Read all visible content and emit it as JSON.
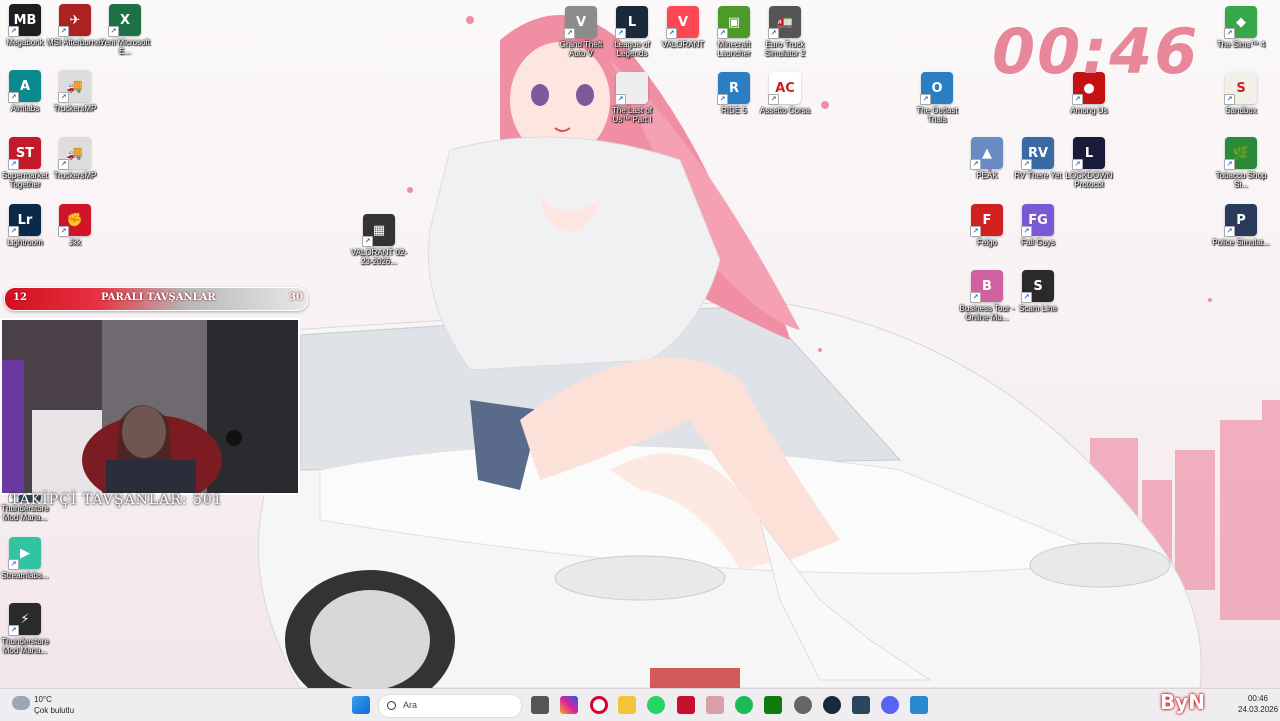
{
  "clock": {
    "time": "00:46"
  },
  "desktop_icons": [
    {
      "id": "megabonk",
      "label": "Megabonk",
      "color": "#1e1e1e",
      "glyph": "MB"
    },
    {
      "id": "msi-afterburner",
      "label": "MSI Afterburner",
      "color": "#a22",
      "glyph": "✈"
    },
    {
      "id": "excel",
      "label": "Yeni Microsoft E...",
      "color": "#1e7145",
      "glyph": "X"
    },
    {
      "id": "aimlab",
      "label": "Aimlabs",
      "color": "#0a8a8f",
      "glyph": "A"
    },
    {
      "id": "trucker-mp-1",
      "label": "TruckersMP",
      "color": "#ddd",
      "glyph": "🚚"
    },
    {
      "id": "supermarket",
      "label": "Supermarket Together",
      "color": "#c21a2a",
      "glyph": "ST"
    },
    {
      "id": "trucker-mp-2",
      "label": "TruckersMP",
      "color": "#ddd",
      "glyph": "🚚"
    },
    {
      "id": "lightroom",
      "label": "Lightroom",
      "color": "#0a2a4a",
      "glyph": "Lr"
    },
    {
      "id": "jkk",
      "label": "Jkk",
      "color": "#d01528",
      "glyph": "✊"
    },
    {
      "id": "valorant-video",
      "label": "VALORANT 02-23-2026...",
      "color": "#333",
      "glyph": "▦"
    },
    {
      "id": "gta5",
      "label": "Grand Theft Auto V",
      "color": "#8c8c8c",
      "glyph": "V"
    },
    {
      "id": "lol",
      "label": "League of Legends",
      "color": "#1b2a3a",
      "glyph": "L"
    },
    {
      "id": "valorant",
      "label": "VALORANT",
      "color": "#ff4655",
      "glyph": "V"
    },
    {
      "id": "minecraft",
      "label": "Minecraft Launcher",
      "color": "#4c9a2a",
      "glyph": "▣"
    },
    {
      "id": "ets2",
      "label": "Euro Truck Simulator 2",
      "color": "#555",
      "glyph": "🚛"
    },
    {
      "id": "last-of-us",
      "label": "The Last of Us™ Part I",
      "color": "#eee",
      "glyph": ""
    },
    {
      "id": "ride5",
      "label": "RIDE 5",
      "color": "#2a7fc4",
      "glyph": "R"
    },
    {
      "id": "assetto",
      "label": "Assetto Corsa",
      "color": "#fff",
      "glyph": "AC"
    },
    {
      "id": "outlast",
      "label": "The Outlast Trials",
      "color": "#2a7fc4",
      "glyph": "O"
    },
    {
      "id": "among-us",
      "label": "Among Us",
      "color": "#c51111",
      "glyph": "●"
    },
    {
      "id": "sims4",
      "label": "The Sims™ 4",
      "color": "#3aa64a",
      "glyph": "◆"
    },
    {
      "id": "sandbox",
      "label": "Sandbox",
      "color": "#f0f0e8",
      "glyph": "S"
    },
    {
      "id": "peak",
      "label": "PEAK",
      "color": "#6a8ac4",
      "glyph": "▲"
    },
    {
      "id": "rv-there",
      "label": "RV There Yet",
      "color": "#3a6aa4",
      "glyph": "RV"
    },
    {
      "id": "lockdown",
      "label": "LOCKDOWN Protocol",
      "color": "#1a1a3a",
      "glyph": "L"
    },
    {
      "id": "tobacco",
      "label": "Tobacco Shop Si...",
      "color": "#2a8a3a",
      "glyph": "🌿"
    },
    {
      "id": "felgo",
      "label": "Felgo",
      "color": "#d02020",
      "glyph": "F"
    },
    {
      "id": "fall-guys",
      "label": "Fall Guys",
      "color": "#7a5ad4",
      "glyph": "FG"
    },
    {
      "id": "police-sim",
      "label": "Police Simulat...",
      "color": "#2a3a5a",
      "glyph": "P"
    },
    {
      "id": "business-tour",
      "label": "Business Tour - Online Mu...",
      "color": "#d060a0",
      "glyph": "B"
    },
    {
      "id": "scam-line",
      "label": "Scam Line",
      "color": "#2a2a2a",
      "glyph": "S"
    },
    {
      "id": "thunderstore-1",
      "label": "Thunderstore Mod Mana...",
      "color": "#2a4a5a",
      "glyph": "⚡"
    },
    {
      "id": "streamlabs",
      "label": "Streamlabs...",
      "color": "#31c3a2",
      "glyph": "▶"
    },
    {
      "id": "thunderstore-2",
      "label": "Thunderstore Mod Mana...",
      "color": "#2a2a2a",
      "glyph": "⚡"
    }
  ],
  "overlay": {
    "bar_left": "12",
    "bar_title": "PARALI TAVŞANLAR",
    "bar_right": "30",
    "followers": "TAKİPÇİ TAVŞANLAR: 501"
  },
  "taskbar": {
    "weather_temp": "10°C",
    "weather_desc": "Çok bulutlu",
    "search_placeholder": "Ara",
    "time": "00:46",
    "date": "24.03.2026",
    "apps": [
      "windows-start",
      "search",
      "task-view",
      "instagram",
      "opera",
      "file-explorer",
      "whatsapp",
      "unknown-app",
      "photos",
      "spotify",
      "xbox",
      "chrome",
      "steam",
      "epic",
      "discord",
      "photo-editor"
    ]
  },
  "corner_logo": "ByN"
}
